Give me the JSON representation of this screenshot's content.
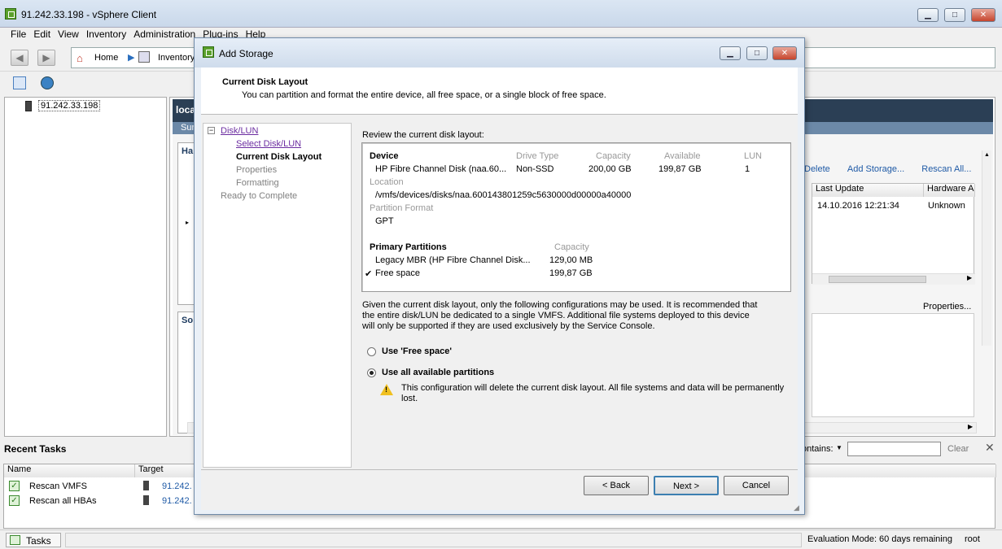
{
  "window": {
    "title": "91.242.33.198 - vSphere Client"
  },
  "menu": [
    "File",
    "Edit",
    "View",
    "Inventory",
    "Administration",
    "Plug-ins",
    "Help"
  ],
  "nav": {
    "home": "Home",
    "inventory": "Inventory"
  },
  "tree": {
    "host": "91.242.33.198"
  },
  "background": {
    "header_text": "loca",
    "tab_stub": "Sur",
    "panel_stub_1": "Ha",
    "panel_stub_2": "So",
    "actions": {
      "delete": "Delete",
      "add_storage": "Add Storage...",
      "rescan_all": "Rescan All..."
    },
    "columns": [
      "Last Update",
      "Hardware A"
    ],
    "row": {
      "last_update": "14.10.2016 12:21:34",
      "hardware": "Unknown"
    },
    "properties": "Properties...",
    "filter_label": "ontains:",
    "clear": "Clear"
  },
  "recent_tasks": {
    "title": "Recent Tasks",
    "columns": [
      "Name",
      "Target"
    ],
    "rows": [
      {
        "name": "Rescan VMFS",
        "target": "91.242."
      },
      {
        "name": "Rescan all HBAs",
        "target": "91.242."
      }
    ]
  },
  "statusbar": {
    "tasks": "Tasks",
    "eval": "Evaluation Mode: 60 days remaining",
    "user": "root"
  },
  "dialog": {
    "title": "Add Storage",
    "header_title": "Current Disk Layout",
    "header_sub": "You can partition and format the entire device, all free space, or a single block of free space.",
    "steps": {
      "disk_lun": "Disk/LUN",
      "select_disk": "Select Disk/LUN",
      "current_layout": "Current Disk Layout",
      "properties": "Properties",
      "formatting": "Formatting",
      "ready": "Ready to Complete"
    },
    "review_label": "Review the current disk layout:",
    "device": {
      "col_device": "Device",
      "col_drive_type": "Drive Type",
      "col_capacity": "Capacity",
      "col_available": "Available",
      "col_lun": "LUN",
      "name": "HP Fibre Channel Disk (naa.60...",
      "drive_type": "Non-SSD",
      "capacity": "200,00 GB",
      "available": "199,87 GB",
      "lun": "1",
      "location_label": "Location",
      "location": "/vmfs/devices/disks/naa.600143801259c5630000d00000a40000",
      "partition_format_label": "Partition Format",
      "partition_format": "GPT"
    },
    "partitions": {
      "title": "Primary Partitions",
      "capacity_label": "Capacity",
      "rows": [
        {
          "name": "Legacy MBR (HP Fibre Channel Disk...",
          "capacity": "129,00 MB",
          "check": ""
        },
        {
          "name": "Free space",
          "capacity": "199,87 GB",
          "check": "✔"
        }
      ]
    },
    "info": "Given the current disk layout, only the following configurations may be used. It is recommended that the entire disk/LUN be dedicated to a single VMFS. Additional file systems deployed to this device will only be supported if they are used exclusively by the Service Console.",
    "option_free": "Use 'Free space'",
    "option_all": "Use all available partitions",
    "warning": "This configuration will delete the current disk layout. All file systems and data will be permanently lost.",
    "buttons": {
      "back": "< Back",
      "next": "Next >",
      "cancel": "Cancel"
    }
  }
}
